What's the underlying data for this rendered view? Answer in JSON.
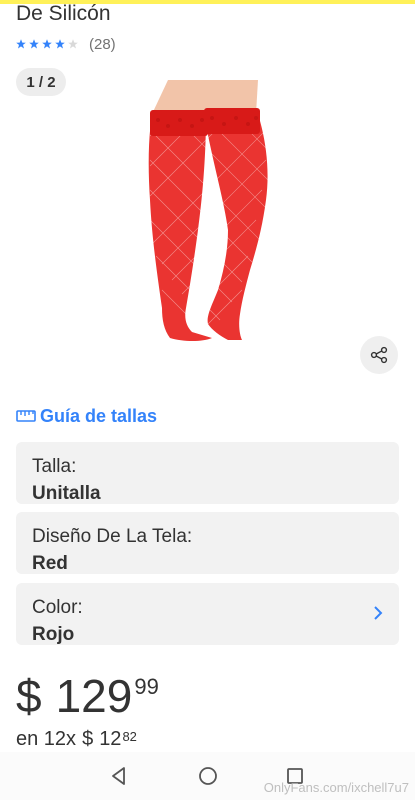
{
  "product": {
    "title": "De Silicón",
    "rating": {
      "stars": 4,
      "max": 5,
      "count": "(28)"
    }
  },
  "gallery": {
    "counter": "1 / 2",
    "image_icon": "red-fishnet-thigh-high-stockings-image"
  },
  "share": {
    "icon": "share-icon"
  },
  "size_guide": {
    "label": "Guía de tallas",
    "icon": "ruler-icon"
  },
  "specs": [
    {
      "label": "Talla:",
      "value": "Unitalla"
    },
    {
      "label": "Diseño De La Tela:",
      "value": "Red"
    },
    {
      "label": "Color:",
      "value": "Rojo"
    }
  ],
  "price": {
    "symbol": "$",
    "integer": "129",
    "cents": "99"
  },
  "installments": {
    "prefix": "en 12x",
    "symbol": "$",
    "integer": "12",
    "cents": "82"
  },
  "navbar": {
    "icons": [
      "back-icon",
      "home-icon",
      "recent-apps-icon"
    ]
  },
  "watermark": "OnlyFans.com/ixchell7u7",
  "colors": {
    "accent": "#3483fa",
    "topbar": "#fff159",
    "stocking": "#e8231f",
    "card_bg": "#f2f2f2"
  }
}
